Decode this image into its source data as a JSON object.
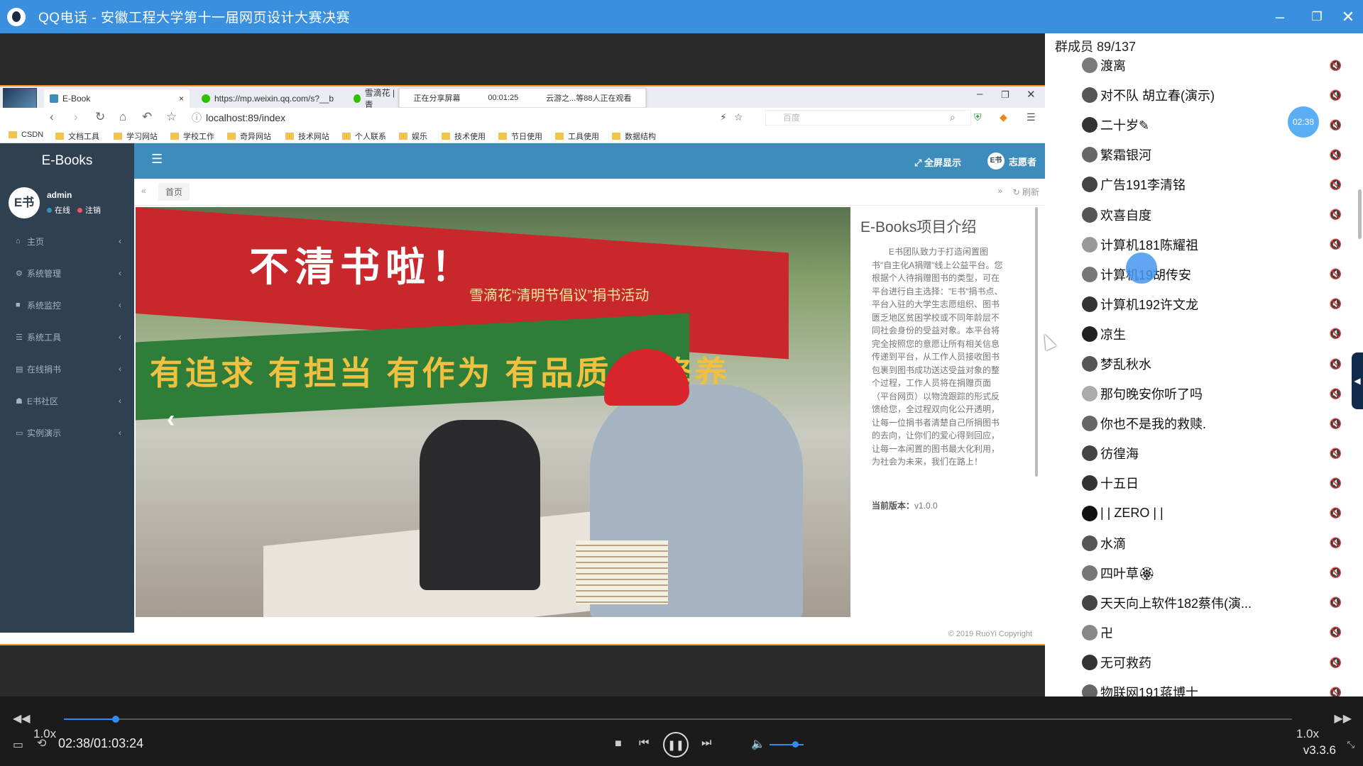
{
  "window": {
    "title": "QQ电话 - 安徽工程大学第十一届网页设计大赛决赛",
    "controls": {
      "minimize": "–",
      "restore": "❐",
      "close": "✕"
    }
  },
  "browser": {
    "tabs": [
      {
        "label": "E-Book",
        "close": "×"
      },
      {
        "label": "https://mp.weixin.qq.com/s?__b"
      },
      {
        "label": "雪滴花 | 青"
      }
    ],
    "share_banner": {
      "status": "正在分享屏幕",
      "duration": "00:01:25",
      "viewers": "云游之...等88人正在观看"
    },
    "url": "localhost:89/index",
    "search_placeholder": "百度",
    "bookmarks": [
      "CSDN",
      "文档工具",
      "学习网站",
      "学校工作",
      "奇异网站",
      "技术网站",
      "个人联系",
      "娱乐",
      "技术使用",
      "节日使用",
      "工具使用",
      "数据结构"
    ]
  },
  "admin": {
    "brand": "E-Books",
    "nav": {
      "fullscreen": "全屏显示",
      "volunteer": "志愿者",
      "avatar_text": "E书"
    },
    "user": {
      "avatar_text": "E书",
      "name": "admin",
      "online": "在线",
      "logout": "注销"
    },
    "menu": [
      {
        "icon": "home-icon",
        "glyph": "⌂",
        "label": "主页"
      },
      {
        "icon": "gear-icon",
        "glyph": "⚙",
        "label": "系统管理"
      },
      {
        "icon": "video-icon",
        "glyph": "■",
        "label": "系统监控"
      },
      {
        "icon": "list-icon",
        "glyph": "☰",
        "label": "系统工具"
      },
      {
        "icon": "book-icon",
        "glyph": "▤",
        "label": "在线捐书"
      },
      {
        "icon": "users-icon",
        "glyph": "☗",
        "label": "E书社区"
      },
      {
        "icon": "monitor-icon",
        "glyph": "▭",
        "label": "实例演示"
      }
    ],
    "breadcrumb": {
      "home": "首页",
      "refresh": "刷新"
    },
    "photo": {
      "banner_text": "不清书啦！",
      "banner_sub": "雪滴花“清明节倡议”捐书活动",
      "green_text": "有追求 有担当 有作为 有品质 有修养"
    },
    "intro": {
      "title": "E-Books项目介绍",
      "body": "E书团队致力于打造闲置图书\"自主化A捐赠\"线上公益平台。您根据个人待捐赠图书的类型，可在平台进行自主选择：\"E书\"捐书点、平台入驻的大学生志愿组织、图书匮乏地区贫困学校或不同年龄层不同社会身份的受益对象。本平台将完全按照您的意愿让所有相关信息传递到平台，从工作人员接收图书包裹到图书成功送达受益对象的整个过程，工作人员将在捐赠页面（平台网页）以物流跟踪的形式反馈给您，全过程双向化公开透明，让每一位捐书者清楚自己所捐图书的去向，让你们的爱心得到回应，让每一本闲置的图书最大化利用，为社会为未来，我们在路上！",
      "version_label": "当前版本：",
      "version_value": "v1.0.0"
    },
    "copyright": "© 2019 RuoYi Copyright"
  },
  "members": {
    "title": "群成员 89/137",
    "timer": "02:38",
    "list": [
      {
        "name": "渡离",
        "color": "#7a7a7a"
      },
      {
        "name": "对不队 胡立春(演示)",
        "color": "#555"
      },
      {
        "name": "二十岁✎",
        "color": "#333"
      },
      {
        "name": "繁霜银河",
        "color": "#666"
      },
      {
        "name": "广告191李清铭",
        "color": "#444"
      },
      {
        "name": "欢喜自度",
        "color": "#555"
      },
      {
        "name": "计算机181陈耀祖",
        "color": "#999"
      },
      {
        "name": "计算机19胡传安",
        "color": "#777"
      },
      {
        "name": "计算机192许文龙",
        "color": "#333"
      },
      {
        "name": "凉生",
        "color": "#222"
      },
      {
        "name": "梦乱秋水",
        "color": "#555"
      },
      {
        "name": "那句晚安你听了吗",
        "color": "#aaa"
      },
      {
        "name": "你也不是我的救赎.",
        "color": "#666"
      },
      {
        "name": "彷徨海",
        "color": "#444"
      },
      {
        "name": "十五日",
        "color": "#333"
      },
      {
        "name": "| | ZERO | |",
        "color": "#111"
      },
      {
        "name": "水滴",
        "color": "#555"
      },
      {
        "name": "四叶草🏵",
        "color": "#777"
      },
      {
        "name": "天天向上软件182蔡伟(演...",
        "color": "#444"
      },
      {
        "name": "卍",
        "color": "#888"
      },
      {
        "name": "无可救药",
        "color": "#333"
      },
      {
        "name": "物联网191蒋博士",
        "color": "#666"
      }
    ]
  },
  "player": {
    "speed_left": "1.0x",
    "speed_right": "1.0x",
    "time": "02:38/01:03:24",
    "version": "v3.3.6",
    "progress": 0.042,
    "volume": 0.75
  }
}
